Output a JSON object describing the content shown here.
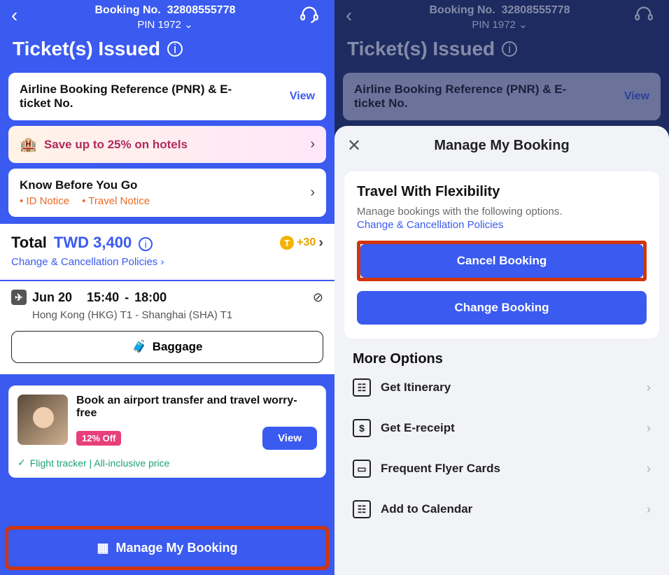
{
  "header": {
    "booking_no_label": "Booking No.",
    "booking_no": "32808555778",
    "pin_label": "PIN",
    "pin": "1972",
    "status": "Ticket(s) Issued"
  },
  "pnr": {
    "label": "Airline Booking Reference (PNR) & E-ticket No.",
    "action": "View"
  },
  "promo": {
    "text": "Save up to 25% on hotels"
  },
  "kbyg": {
    "title": "Know Before You Go",
    "id_notice": "ID Notice",
    "travel_notice": "Travel Notice"
  },
  "total": {
    "label": "Total",
    "currency": "TWD",
    "amount": "3,400",
    "reward": "+30",
    "policy_link": "Change & Cancellation Policies"
  },
  "segment": {
    "date": "Jun 20",
    "dep_time": "15:40",
    "arr_time": "18:00",
    "route": "Hong Kong (HKG) T1 - Shanghai (SHA) T1",
    "baggage_btn": "Baggage"
  },
  "transfer": {
    "title": "Book an airport transfer and travel worry-free",
    "discount": "12% Off",
    "view": "View",
    "footer": "Flight tracker | All-inclusive price"
  },
  "manage_btn": "Manage My Booking",
  "sheet": {
    "title": "Manage My Booking",
    "section_title": "Travel With Flexibility",
    "section_sub": "Manage bookings with the following options.",
    "section_link": "Change & Cancellation Policies",
    "cancel": "Cancel Booking",
    "change": "Change Booking",
    "more_title": "More Options",
    "opts": {
      "itinerary": "Get Itinerary",
      "ereceipt": "Get E-receipt",
      "ffc": "Frequent Flyer Cards",
      "calendar": "Add to Calendar"
    }
  }
}
